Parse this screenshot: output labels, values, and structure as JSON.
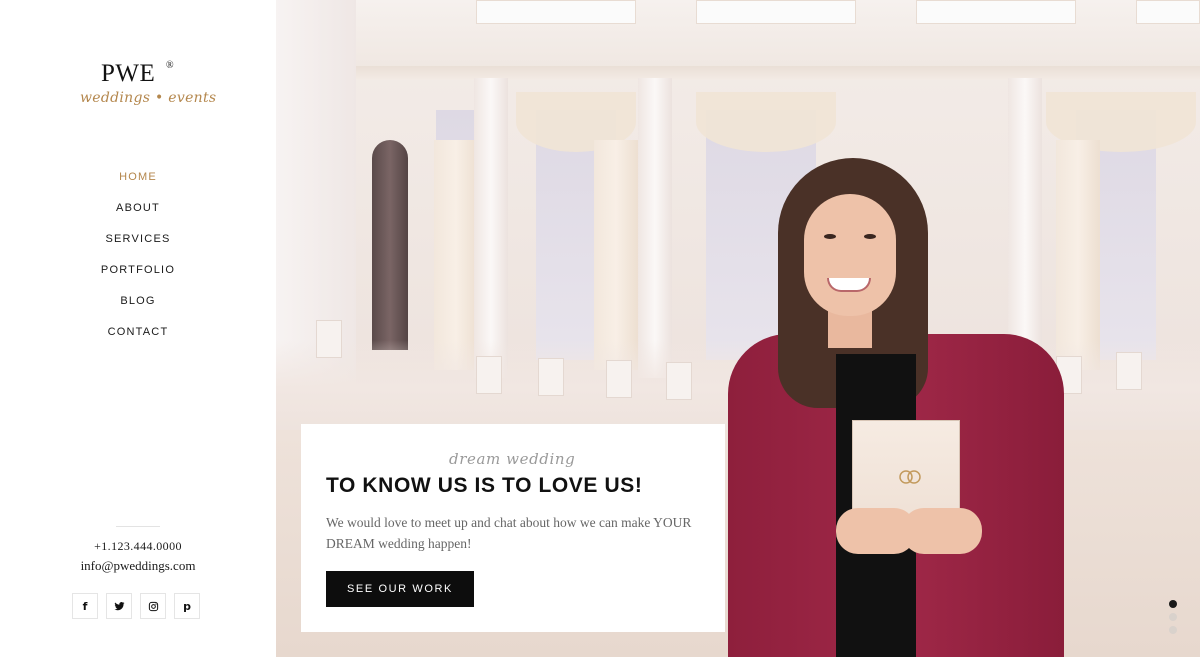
{
  "brand": {
    "mark": "PWE",
    "registered": "®",
    "script": "weddings • events"
  },
  "nav": {
    "items": [
      {
        "label": "HOME",
        "active": true
      },
      {
        "label": "ABOUT",
        "active": false
      },
      {
        "label": "SERVICES",
        "active": false
      },
      {
        "label": "PORTFOLIO",
        "active": false
      },
      {
        "label": "BLOG",
        "active": false
      },
      {
        "label": "CONTACT",
        "active": false
      }
    ]
  },
  "contact": {
    "phone": "+1.123.444.0000",
    "email": "info@pweddings.com"
  },
  "social": [
    {
      "icon": "facebook-icon",
      "glyph": "f"
    },
    {
      "icon": "twitter-icon",
      "glyph": ""
    },
    {
      "icon": "instagram-icon",
      "glyph": ""
    },
    {
      "icon": "pinterest-icon",
      "glyph": "p"
    }
  ],
  "hero": {
    "script": "dream wedding",
    "title": "TO KNOW US IS TO LOVE US!",
    "text": "We would love to meet up and chat about how we can make YOUR DREAM wedding happen!",
    "button_label": "SEE OUR WORK"
  },
  "slider": {
    "count": 3,
    "active_index": 0
  },
  "colors": {
    "accent": "#b4874d",
    "button": "#0d0d0d",
    "blazer": "#9a2545"
  }
}
